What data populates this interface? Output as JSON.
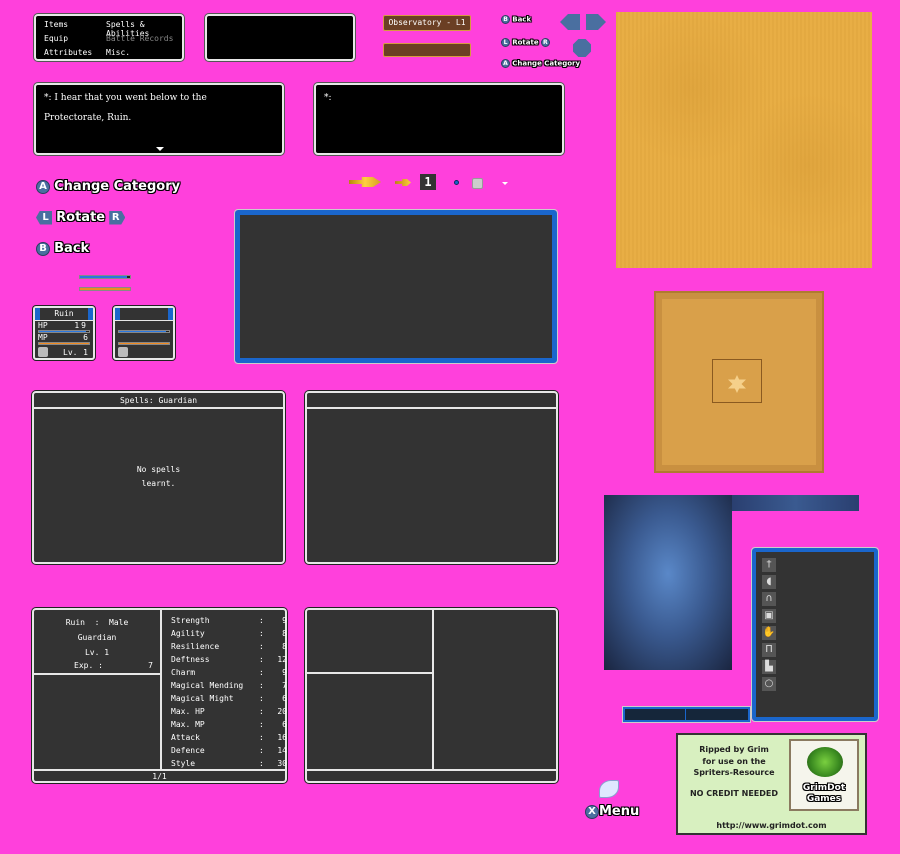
{
  "main_menu": {
    "items": [
      "Items",
      "Spells & Abilities",
      "Equip",
      "Battle Records",
      "Attributes",
      "Misc."
    ],
    "disabled": [
      "Battle Records"
    ]
  },
  "location_plate": {
    "label": "Observatory - L1"
  },
  "small_hints": {
    "back": "Back",
    "rotate": "Rotate",
    "change_category": "Change Category",
    "btn_b": "B",
    "btn_l": "L",
    "btn_r": "R",
    "btn_a": "A"
  },
  "dialogue": {
    "speaker_mark": "*:",
    "line1": "*: I hear that you went below to the",
    "line2": "Protectorate, Ruin.",
    "empty_mark": "*:",
    "advance_icon": "triangle-down-icon"
  },
  "large_hints": {
    "change_category": "Change Category",
    "rotate": "Rotate",
    "back": "Back",
    "btn_a": "A",
    "btn_l": "L",
    "btn_r": "R",
    "btn_b": "B"
  },
  "cursor_row": {
    "quantity": "1",
    "icons": [
      "large-cursor-icon",
      "small-cursor-icon",
      "dot-icon",
      "emblem-icon",
      "caret-down-icon"
    ]
  },
  "party_card": {
    "name": "Ruin",
    "hp_label": "HP",
    "hp_value": "19",
    "mp_label": "MP",
    "mp_value": "6",
    "level_label": "Lv.",
    "level_value": "1",
    "hp_fraction": 0.93,
    "mp_fraction": 1.0
  },
  "sample_bars": {
    "hp_fraction": 0.93,
    "mp_fraction": 1.0
  },
  "spells_panel": {
    "title": "Spells: Guardian",
    "empty_line1": "No spells",
    "empty_line2": "learnt."
  },
  "attributes_panel": {
    "name_line": "Ruin  :  Male",
    "vocation": "Guardian",
    "level": "Lv. 1",
    "exp_label": "Exp. :",
    "exp_value": "7",
    "page": "1/1",
    "stats": [
      {
        "name": "Strength",
        "value": "9"
      },
      {
        "name": "Agility",
        "value": "8"
      },
      {
        "name": "Resilience",
        "value": "8"
      },
      {
        "name": "Deftness",
        "value": "12"
      },
      {
        "name": "Charm",
        "value": "9"
      },
      {
        "name": "Magical Mending",
        "value": "7"
      },
      {
        "name": "Magical Might",
        "value": "6"
      },
      {
        "name": "Max. HP",
        "value": "20"
      },
      {
        "name": "Max. MP",
        "value": "6"
      },
      {
        "name": "Attack",
        "value": "16"
      },
      {
        "name": "Defence",
        "value": "14"
      },
      {
        "name": "Style",
        "value": "30"
      }
    ]
  },
  "equip_slots": [
    {
      "icon": "sword-icon",
      "glyph": "†"
    },
    {
      "icon": "shield-icon",
      "glyph": "◖"
    },
    {
      "icon": "helmet-icon",
      "glyph": "∩"
    },
    {
      "icon": "armor-icon",
      "glyph": "▣"
    },
    {
      "icon": "gauntlet-icon",
      "glyph": "✋"
    },
    {
      "icon": "leggings-icon",
      "glyph": "Π"
    },
    {
      "icon": "boots-icon",
      "glyph": "▙"
    },
    {
      "icon": "ring-icon",
      "glyph": "○"
    }
  ],
  "menu_button": {
    "btn": "X",
    "label": "Menu"
  },
  "credit": {
    "line1": "Ripped by Grim",
    "line2": "for use on the",
    "line3": "Spriters-Resource",
    "line4": "NO CREDIT NEEDED",
    "url": "http://www.grimdot.com",
    "logo_line1": "GrimDot",
    "logo_line2": "Games"
  },
  "colors": {
    "background": "#ff40dc",
    "window_dark": "#333333",
    "window_border": "#e8e8e8",
    "hp_blue": "#2a78e0",
    "mp_orange": "#f08a20",
    "accent_blue": "#1a66cc",
    "plate_brown": "#6b3f24",
    "sand": "#e8ae45"
  }
}
